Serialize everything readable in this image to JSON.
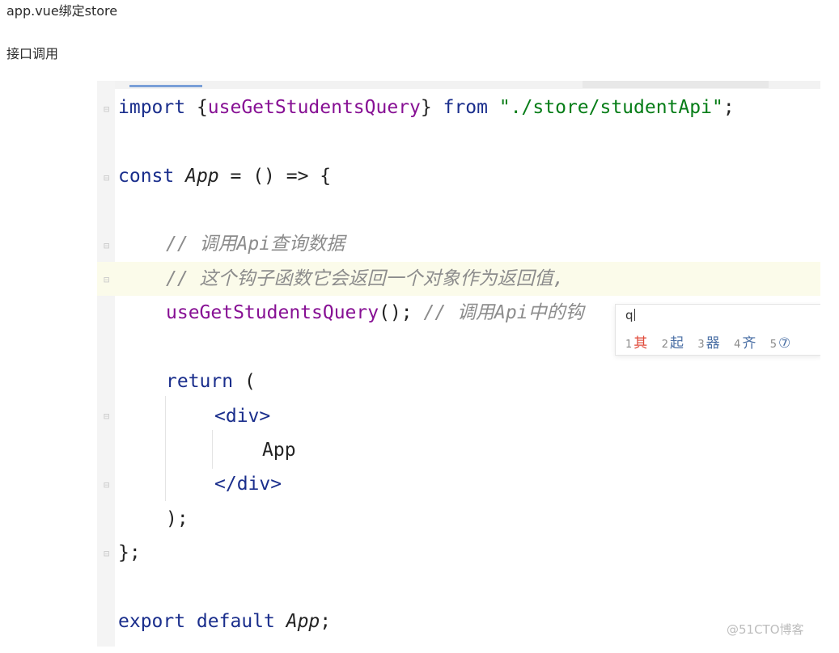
{
  "article": {
    "para1": "app.vue绑定store",
    "para2": "接口调用"
  },
  "code": {
    "line1": {
      "kw": "import",
      "open": " {",
      "id": "useGetStudentsQuery",
      "close": "} ",
      "kw2": "from",
      "sp": " ",
      "str": "\"./store/studentApi\"",
      "end": ";"
    },
    "line2": {
      "kw": "const",
      "sp": " ",
      "name": "App",
      "rest": " = () => {"
    },
    "line3": {
      "comment": "// 调用Api查询数据"
    },
    "line4": {
      "comment": "// 这个钩子函数它会返回一个对象作为返回值,"
    },
    "line5": {
      "call": "useGetStudentsQuery",
      "rest": "(); ",
      "comment": "// 调用Api中的钩"
    },
    "line6": {
      "kw": "return",
      "rest": " ("
    },
    "line7": {
      "tag": "<div>"
    },
    "line8": {
      "text": "App"
    },
    "line9": {
      "tag": "</div>"
    },
    "line10": {
      "text": ");"
    },
    "line11": {
      "text": "};"
    },
    "line12": {
      "kw": "export default",
      "sp": " ",
      "name": "App",
      "end": ";"
    }
  },
  "ime": {
    "input": "q",
    "candidates": [
      {
        "num": "1",
        "text": "其"
      },
      {
        "num": "2",
        "text": "起"
      },
      {
        "num": "3",
        "text": "器"
      },
      {
        "num": "4",
        "text": "齐"
      },
      {
        "num": "5",
        "text": "⑦"
      }
    ]
  },
  "watermark": "@51CTO博客",
  "icons": [
    "fold-marker-icon",
    "help-circle-icon"
  ]
}
